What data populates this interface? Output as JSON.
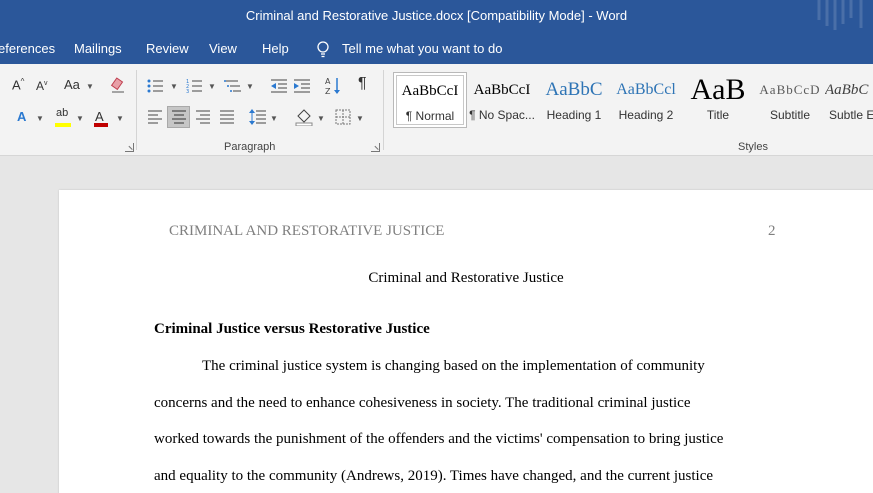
{
  "window": {
    "title": "Criminal and Restorative Justice.docx [Compatibility Mode]  -  Word"
  },
  "tabs": {
    "references": "eferences",
    "mailings": "Mailings",
    "review": "Review",
    "view": "View",
    "help": "Help",
    "tell_me": "Tell me what you want to do"
  },
  "ribbon": {
    "paragraph_label": "Paragraph",
    "styles_label": "Styles",
    "font_buttons": {
      "grow": "A",
      "shrink": "A",
      "change_case": "Aa",
      "font_color": "A",
      "text_effects": "A",
      "highlight": "ab"
    },
    "styles": [
      {
        "preview": "AaBbCcI",
        "label": "¶ Normal"
      },
      {
        "preview": "AaBbCcI",
        "label": "¶ No Spac..."
      },
      {
        "preview": "AaBbC",
        "label": "Heading 1"
      },
      {
        "preview": "AaBbCcl",
        "label": "Heading 2"
      },
      {
        "preview": "AaB",
        "label": "Title"
      },
      {
        "preview": "AaBbCcD",
        "label": "Subtitle"
      },
      {
        "preview": "AaBbC",
        "label": "Subtle E"
      }
    ]
  },
  "colors": {
    "accent": "#2b579a",
    "highlight": "#ffff00",
    "font_color": "#c00000"
  },
  "document": {
    "header_text": "CRIMINAL AND RESTORATIVE JUSTICE",
    "page_number": "2",
    "title": "Criminal and Restorative Justice",
    "heading": "Criminal Justice versus Restorative Justice",
    "lines": [
      "The criminal justice system is changing based on the implementation of community",
      "concerns and the need to enhance cohesiveness in society. The traditional criminal justice",
      "worked towards the punishment of the offenders and the victims' compensation to bring justice",
      "and equality to the community (Andrews, 2019). Times have changed, and the current justice"
    ]
  }
}
